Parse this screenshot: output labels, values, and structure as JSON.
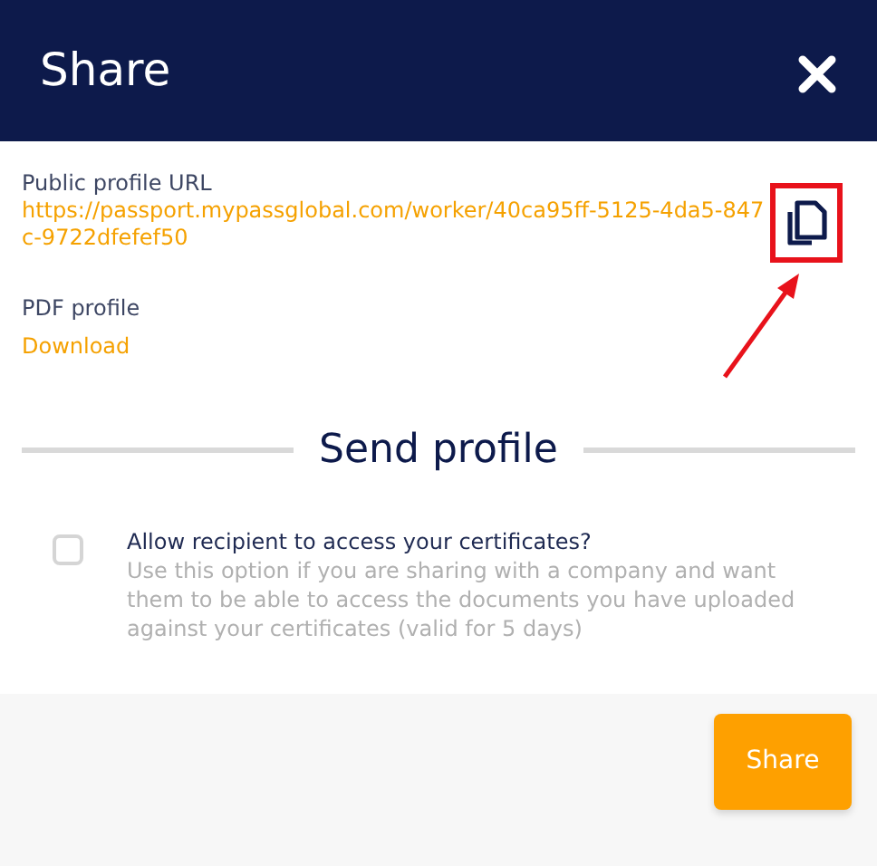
{
  "window": {
    "title": "Share"
  },
  "public_url": {
    "label": "Public profile URL",
    "url": "https://passport.mypassglobal.com/worker/40ca95ff-5125-4da5-847c-9722dfefef50",
    "highlighted": true
  },
  "pdf": {
    "label": "PDF profile",
    "link": "Download"
  },
  "send_profile": {
    "heading": "Send profile",
    "option": {
      "label": "Allow recipient to access your certificates?",
      "description": "Use this option if you are sharing with a company and want them to be able to access the documents you have uploaded against your certificates (valid for 5 days)",
      "checked": false
    }
  },
  "buttons": [
    "Share"
  ]
}
